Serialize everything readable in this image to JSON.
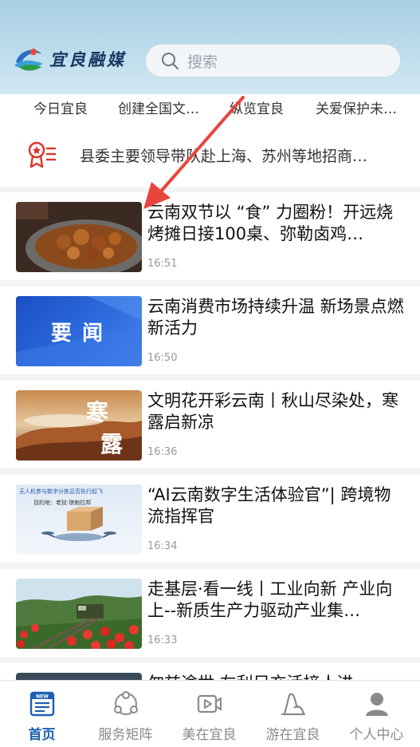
{
  "header": {
    "logo_text": "宜良融媒",
    "search_placeholder": "搜索"
  },
  "tabs": [
    "今日宜良",
    "创建全国文…",
    "纵览宜良",
    "关爱保护未…"
  ],
  "notice": {
    "icon": "ribbon-list-icon",
    "text": "县委主要领导带队赴上海、苏州等地招商…"
  },
  "articles": [
    {
      "title": "云南双节以 “食” 力圈粉！开远烧烤摊日接100桌、弥勒卤鸡…",
      "time": "16:51",
      "thumb": "food-photo"
    },
    {
      "title": "云南消费市场持续升温 新场景点燃新活力",
      "time": "16:50",
      "thumb_text": "要 闻"
    },
    {
      "title": "文明花开彩云南丨秋山尽染处，寒露启新凉",
      "time": "16:36",
      "thumb_text_1": "寒",
      "thumb_text_2": "露"
    },
    {
      "title": "“AI云南数字生活体验官”| 跨境物流指挥官",
      "time": "16:34",
      "thumb_text": "无人机参与数字分拣显否执行起飞",
      "thumb_text_2": "目的地：老挝·琅勃拉邦"
    },
    {
      "title": "走基层·看一线丨工业向新 产业向上--新质生产力驱动产业集…",
      "time": "16:33",
      "thumb": "railway-flowers-photo"
    }
  ],
  "partial_title": "勿兹途世 左利只充活接人进",
  "tabbar": [
    {
      "label": "首页",
      "icon": "news-icon",
      "active": true
    },
    {
      "label": "服务矩阵",
      "icon": "service-matrix-icon",
      "active": false
    },
    {
      "label": "美在宜良",
      "icon": "video-play-icon",
      "active": false
    },
    {
      "label": "游在宜良",
      "icon": "travel-icon",
      "active": false
    },
    {
      "label": "个人中心",
      "icon": "user-icon",
      "active": false
    }
  ],
  "colors": {
    "accent": "#1e5fb4",
    "arrow": "#e8453c",
    "header_top": "#a8cfe3"
  }
}
